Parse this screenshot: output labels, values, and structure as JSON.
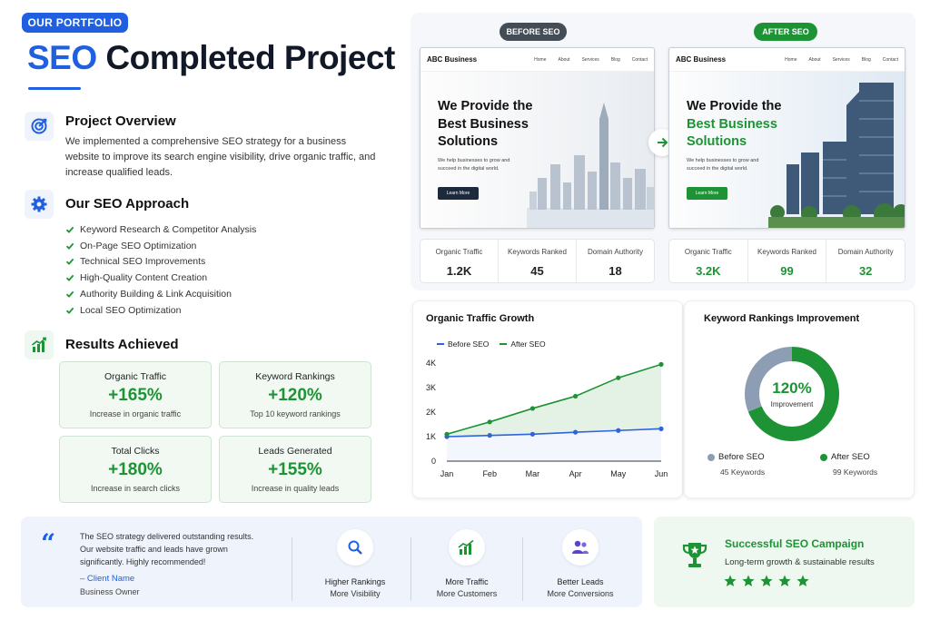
{
  "header": {
    "badge": "OUR PORTFOLIO",
    "title_highlight": "SEO",
    "title_rest": "Completed Project"
  },
  "overview": {
    "icon": "target-icon",
    "title": "Project Overview",
    "text": "We implemented a comprehensive SEO strategy for a business website to improve its search engine visibility, drive organic traffic, and increase qualified leads."
  },
  "approach": {
    "icon": "gear-icon",
    "title": "Our SEO Approach",
    "items": [
      "Keyword Research & Competitor Analysis",
      "On-Page SEO Optimization",
      "Technical SEO Improvements",
      "High-Quality Content Creation",
      "Authority Building & Link Acquisition",
      "Local SEO Optimization"
    ]
  },
  "results": {
    "icon": "bar-chart-icon",
    "title": "Results Achieved",
    "cards": [
      {
        "title": "Organic Traffic",
        "value": "+165%",
        "sub": "Increase in organic traffic"
      },
      {
        "title": "Keyword Rankings",
        "value": "+120%",
        "sub": "Top 10 keyword rankings"
      },
      {
        "title": "Total Clicks",
        "value": "+180%",
        "sub": "Increase in search clicks"
      },
      {
        "title": "Leads Generated",
        "value": "+155%",
        "sub": "Increase in quality leads"
      }
    ]
  },
  "comparison": {
    "before_label": "BEFORE SEO",
    "after_label": "AFTER SEO",
    "site": {
      "brand": "ABC Business",
      "nav": [
        "Home",
        "About",
        "Services",
        "Blog",
        "Contact"
      ],
      "heading_line1": "We Provide the",
      "heading_line2": "Best Business",
      "heading_line3": "Solutions",
      "subtext": "We help businesses to grow and succeed in the digital world.",
      "button": "Learn More"
    },
    "before_stats": [
      {
        "label": "Organic Traffic",
        "value": "1.2K"
      },
      {
        "label": "Keywords Ranked",
        "value": "45"
      },
      {
        "label": "Domain Authority",
        "value": "18"
      }
    ],
    "after_stats": [
      {
        "label": "Organic Traffic",
        "value": "3.2K"
      },
      {
        "label": "Keywords Ranked",
        "value": "99"
      },
      {
        "label": "Domain Authority",
        "value": "32"
      }
    ]
  },
  "traffic_chart": {
    "title": "Organic Traffic Growth",
    "legend_before": "Before SEO",
    "legend_after": "After SEO"
  },
  "rankings_chart": {
    "title": "Keyword Rankings Improvement",
    "center_value": "120%",
    "center_label": "Improvement",
    "before_label": "Before SEO",
    "before_sub": "45 Keywords",
    "after_label": "After SEO",
    "after_sub": "99 Keywords"
  },
  "chart_data": [
    {
      "type": "line",
      "title": "Organic Traffic Growth",
      "x": [
        "Jan",
        "Feb",
        "Mar",
        "Apr",
        "May",
        "Jun"
      ],
      "y_ticks": [
        "0",
        "1K",
        "2K",
        "3K",
        "4K"
      ],
      "ylim": [
        0,
        4000
      ],
      "series": [
        {
          "name": "Before SEO",
          "color": "#2f62dd",
          "values": [
            1000,
            1050,
            1100,
            1180,
            1250,
            1320
          ]
        },
        {
          "name": "After SEO",
          "color": "#1e9335",
          "values": [
            1100,
            1600,
            2150,
            2650,
            3400,
            3950
          ]
        }
      ],
      "legend": "top-left",
      "grid": false
    },
    {
      "type": "pie",
      "title": "Keyword Rankings Improvement",
      "slices": [
        {
          "name": "Before SEO",
          "value": 45,
          "color": "#8d9db3"
        },
        {
          "name": "After SEO",
          "value": 99,
          "color": "#1e9335"
        }
      ]
    }
  ],
  "testimonial": {
    "quote_icon": "quote-icon",
    "text": "The SEO strategy delivered outstanding results. Our website traffic and leads have grown significantly. Highly recommended!",
    "author": "– Client Name",
    "role": "Business Owner"
  },
  "features": [
    {
      "icon": "search-icon",
      "label": "Higher Rankings",
      "sub": "More Visibility"
    },
    {
      "icon": "growth-chart-icon",
      "label": "More Traffic",
      "sub": "More Customers"
    },
    {
      "icon": "users-icon",
      "label": "Better Leads",
      "sub": "More Conversions"
    }
  ],
  "campaign": {
    "icon": "trophy-icon",
    "title": "Successful SEO Campaign",
    "sub": "Long-term growth & sustainable results",
    "stars": 5
  },
  "colors": {
    "blue": "#1f5fe0",
    "green": "#1e9335",
    "gray": "#8d9db3",
    "dark": "#444c56"
  }
}
